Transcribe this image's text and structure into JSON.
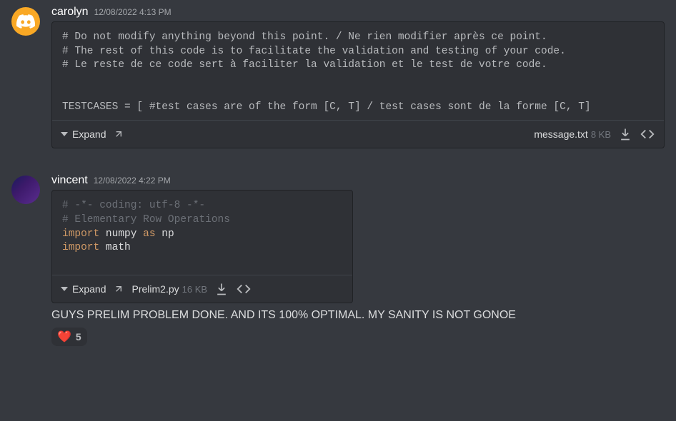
{
  "messages": [
    {
      "username": "carolyn",
      "timestamp": "12/08/2022 4:13 PM",
      "attachment": {
        "code_lines": [
          "# Do not modify anything beyond this point. / Ne rien modifier après ce point.",
          "# The rest of this code is to facilitate the validation and testing of your code.",
          "# Le reste de ce code sert à faciliter la validation et le test de votre code.",
          "",
          "",
          "TESTCASES = [ #test cases are of the form [C, T] / test cases sont de la forme [C, T]"
        ],
        "expand_label": "Expand",
        "filename": "message.txt",
        "filesize": "8 KB"
      }
    },
    {
      "username": "vincent",
      "timestamp": "12/08/2022 4:22 PM",
      "attachment": {
        "code_line1_comment": "# -*- coding: utf-8 -*-",
        "code_line2_comment": "# Elementary Row Operations",
        "import_kw": "import",
        "as_kw": "as",
        "numpy": "numpy",
        "np": "np",
        "math": "math",
        "expand_label": "Expand",
        "filename": "Prelim2.py",
        "filesize": "16 KB"
      },
      "text": "GUYS PRELIM PROBLEM DONE. AND ITS 100% OPTIMAL. MY SANITY IS NOT GONOE",
      "reaction": {
        "emoji": "❤️",
        "count": "5"
      }
    }
  ]
}
